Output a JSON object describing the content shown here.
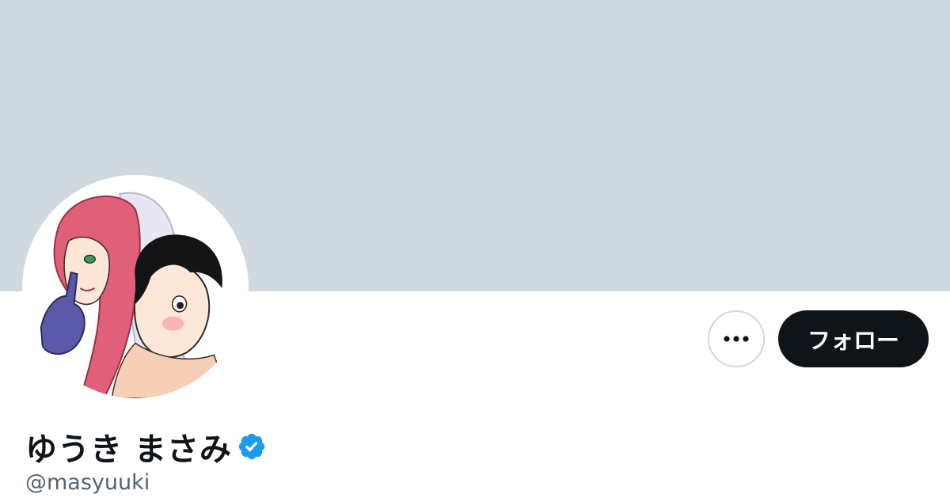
{
  "profile": {
    "display_name": "ゆうき まさみ",
    "handle": "@masyuuki",
    "verified": true,
    "avatar_icon": "manga-characters-avatar"
  },
  "actions": {
    "more_icon": "more-dots-icon",
    "follow_label": "フォロー"
  },
  "colors": {
    "banner": "#cfd9df",
    "follow_bg": "#0f1419",
    "verified": "#1d9bf0",
    "handle_text": "#536471"
  }
}
